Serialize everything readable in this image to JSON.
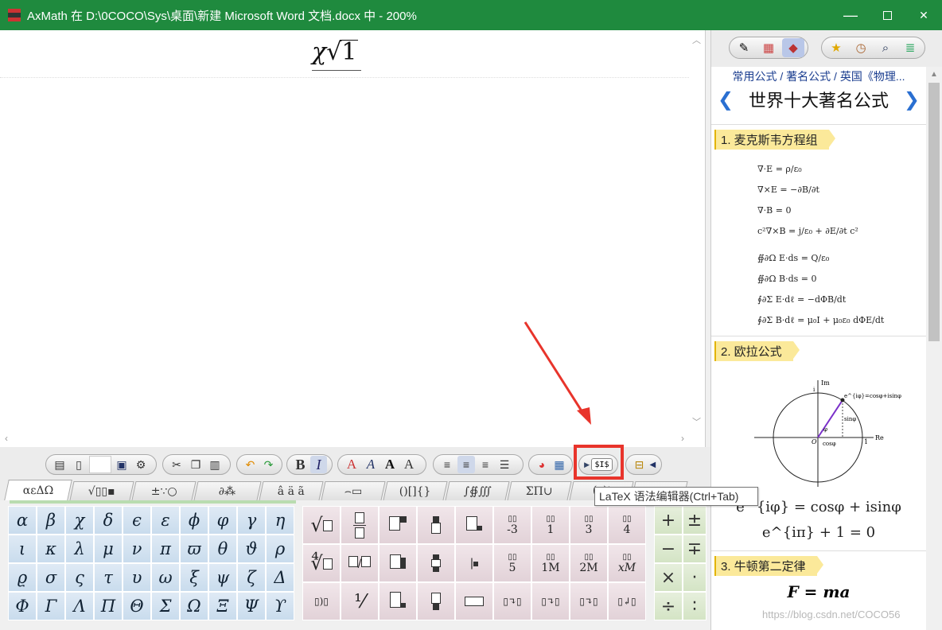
{
  "window": {
    "title": "AxMath 在 D:\\0COCO\\Sys\\桌面\\新建 Microsoft Word 文档.docx 中 - 200%",
    "min": "—",
    "close": "✕"
  },
  "editor": {
    "formula_chi": "χ",
    "formula_sqrt": "√",
    "formula_num": "1"
  },
  "toolbar": {
    "bold": "B",
    "italic": "I",
    "font_a": "A",
    "font_b": "A",
    "font_c": "A",
    "font_d": "A",
    "latex_label": "$I$"
  },
  "tooltip": "LaTeX 语法编辑器(Ctrl+Tab)",
  "tabs": [
    {
      "label": "αεΔΩ"
    },
    {
      "label": "√▯▯▪"
    },
    {
      "label": "±∵○"
    },
    {
      "label": "∂⁂"
    },
    {
      "label": "â ä ã"
    },
    {
      "label": "⌢▭"
    },
    {
      "label": "()[]{}"
    },
    {
      "label": "∫∯∭"
    },
    {
      "label": "ΣΠ∪"
    },
    {
      "label": "(▯)⁞"
    },
    {
      "label": "→⇢"
    }
  ],
  "greek": [
    "α",
    "β",
    "χ",
    "δ",
    "ϵ",
    "ε",
    "ϕ",
    "φ",
    "γ",
    "η",
    "ι",
    "κ",
    "λ",
    "μ",
    "ν",
    "π",
    "ϖ",
    "θ",
    "ϑ",
    "ρ",
    "ϱ",
    "σ",
    "ς",
    "τ",
    "υ",
    "ω",
    "ξ",
    "ψ",
    "ζ",
    "Δ",
    "Φ",
    "Γ",
    "Λ",
    "Π",
    "Θ",
    "Σ",
    "Ω",
    "Ξ",
    "Ψ",
    "ϒ"
  ],
  "templates": {
    "row1_labels": [
      "-3",
      "1",
      "3",
      "4"
    ],
    "row2_labels": [
      "5",
      "1M",
      "2M",
      "xM"
    ]
  },
  "ops": [
    "+",
    "±",
    "−",
    "∓",
    "×",
    "·",
    "÷",
    "∶"
  ],
  "right_panel": {
    "breadcrumb": "常用公式 / 著名公式 / 英国《物理...",
    "title": "世界十大著名公式",
    "nav_prev": "❮",
    "nav_next": "❯",
    "sections": [
      {
        "heading": "1. 麦克斯韦方程组"
      },
      {
        "heading": "2. 欧拉公式"
      },
      {
        "heading": "3. 牛顿第二定律"
      }
    ],
    "maxwell": [
      "∇·E = ρ/ε₀",
      "∇×E = −∂B/∂t",
      "∇·B = 0",
      "c²∇×B = j/ε₀ + ∂E/∂t c²",
      "∯∂Ω E·ds = Q/ε₀",
      "∯∂Ω B·ds = 0",
      "∮∂Σ E·dℓ = −dΦB/dt",
      "∮∂Σ B·dℓ = μ₀I + μ₀ε₀ dΦE/dt"
    ],
    "euler_diagram": {
      "im": "Im",
      "re": "Re",
      "one_x": "1",
      "one_y": "i",
      "origin": "O",
      "phi": "φ",
      "cos": "cosφ",
      "sin": "sinφ",
      "point": "e^{iφ}=cosφ+isinφ"
    },
    "euler_eq1": "e^{iφ} = cosφ + isinφ",
    "euler_eq2": "e^{iπ} + 1 = 0",
    "newton": "F = ma"
  },
  "watermark": "https://blog.csdn.net/COCO56"
}
